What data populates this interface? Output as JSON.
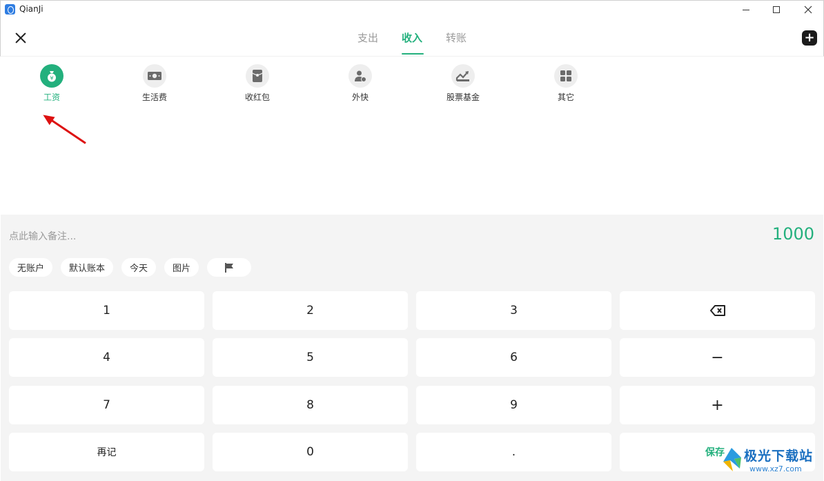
{
  "window": {
    "title": "QianJi"
  },
  "header": {
    "tabs": [
      {
        "label": "支出",
        "active": false
      },
      {
        "label": "收入",
        "active": true
      },
      {
        "label": "转账",
        "active": false
      }
    ],
    "accent_color": "#23b07d"
  },
  "categories": [
    {
      "label": "工资",
      "icon": "money-bag-icon",
      "active": true
    },
    {
      "label": "生活费",
      "icon": "cash-note-icon",
      "active": false
    },
    {
      "label": "收红包",
      "icon": "red-envelope-icon",
      "active": false
    },
    {
      "label": "外快",
      "icon": "person-coin-icon",
      "active": false
    },
    {
      "label": "股票基金",
      "icon": "stock-chart-icon",
      "active": false
    },
    {
      "label": "其它",
      "icon": "grid-icon",
      "active": false
    }
  ],
  "entry": {
    "note_placeholder": "点此输入备注...",
    "amount": "1000"
  },
  "chips": [
    {
      "label": "无账户"
    },
    {
      "label": "默认账本"
    },
    {
      "label": "今天"
    },
    {
      "label": "图片"
    }
  ],
  "keypad": {
    "rows": [
      [
        "1",
        "2",
        "3",
        "backspace"
      ],
      [
        "4",
        "5",
        "6",
        "−"
      ],
      [
        "7",
        "8",
        "9",
        "+"
      ],
      [
        "再记",
        "0",
        ".",
        "保存"
      ]
    ]
  },
  "watermark": {
    "text": "极光下载站",
    "url": "www.xz7.com"
  }
}
